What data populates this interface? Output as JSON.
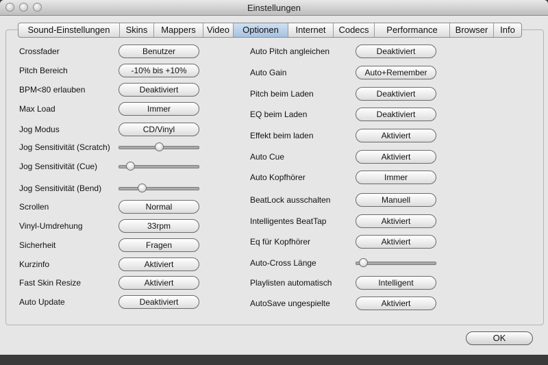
{
  "window": {
    "title": "Einstellungen"
  },
  "tabs": [
    "Sound-Einstellungen",
    "Skins",
    "Mappers",
    "Video",
    "Optionen",
    "Internet",
    "Codecs",
    "Performance",
    "Browser",
    "Info"
  ],
  "active_tab": "Optionen",
  "left_rows": [
    {
      "label": "Crossfader",
      "type": "button",
      "value": "Benutzer"
    },
    {
      "label": "Pitch Bereich",
      "type": "button",
      "value": "-10% bis +10%"
    },
    {
      "label": "BPM<80 erlauben",
      "type": "button",
      "value": "Deaktiviert"
    },
    {
      "label": "Max Load",
      "type": "button",
      "value": "Immer"
    },
    {
      "label": "Jog Modus",
      "type": "button",
      "value": "CD/Vinyl"
    },
    {
      "label": "Jog Sensitivität (Scratch)",
      "type": "slider",
      "level": 0.5
    },
    {
      "label": "Jog Sensitivität (Cue)",
      "type": "slider",
      "level": 0.1
    },
    {
      "label": "Jog Sensitivität (Bend)",
      "type": "slider",
      "level": 0.27
    },
    {
      "label": "Scrollen",
      "type": "button",
      "value": "Normal"
    },
    {
      "label": "Vinyl-Umdrehung",
      "type": "button",
      "value": "33rpm"
    },
    {
      "label": "Sicherheit",
      "type": "button",
      "value": "Fragen"
    },
    {
      "label": "Kurzinfo",
      "type": "button",
      "value": "Aktiviert"
    },
    {
      "label": "Fast Skin Resize",
      "type": "button",
      "value": "Aktiviert"
    },
    {
      "label": "Auto Update",
      "type": "button",
      "value": "Deaktiviert"
    }
  ],
  "right_rows": [
    {
      "label": "Auto Pitch angleichen",
      "type": "button",
      "value": "Deaktiviert"
    },
    {
      "label": "Auto Gain",
      "type": "button",
      "value": "Auto+Remember"
    },
    {
      "label": "Pitch beim Laden",
      "type": "button",
      "value": "Deaktiviert"
    },
    {
      "label": "EQ beim Laden",
      "type": "button",
      "value": "Deaktiviert"
    },
    {
      "label": "Effekt beim laden",
      "type": "button",
      "value": "Aktiviert"
    },
    {
      "label": "Auto Cue",
      "type": "button",
      "value": "Aktiviert"
    },
    {
      "label": "Auto Kopfhörer",
      "type": "button",
      "value": "Immer"
    },
    {
      "label": "BeatLock ausschalten",
      "type": "button",
      "value": "Manuell"
    },
    {
      "label": "Intelligentes BeatTap",
      "type": "button",
      "value": "Aktiviert"
    },
    {
      "label": "Eq für Kopfhörer",
      "type": "button",
      "value": "Aktiviert"
    },
    {
      "label": "Auto-Cross Länge",
      "type": "slider",
      "level": 0.05
    },
    {
      "label": "Playlisten automatisch",
      "type": "button",
      "value": "Intelligent"
    },
    {
      "label": "AutoSave ungespielte",
      "type": "button",
      "value": "Aktiviert"
    }
  ],
  "footer": {
    "ok_label": "OK"
  }
}
